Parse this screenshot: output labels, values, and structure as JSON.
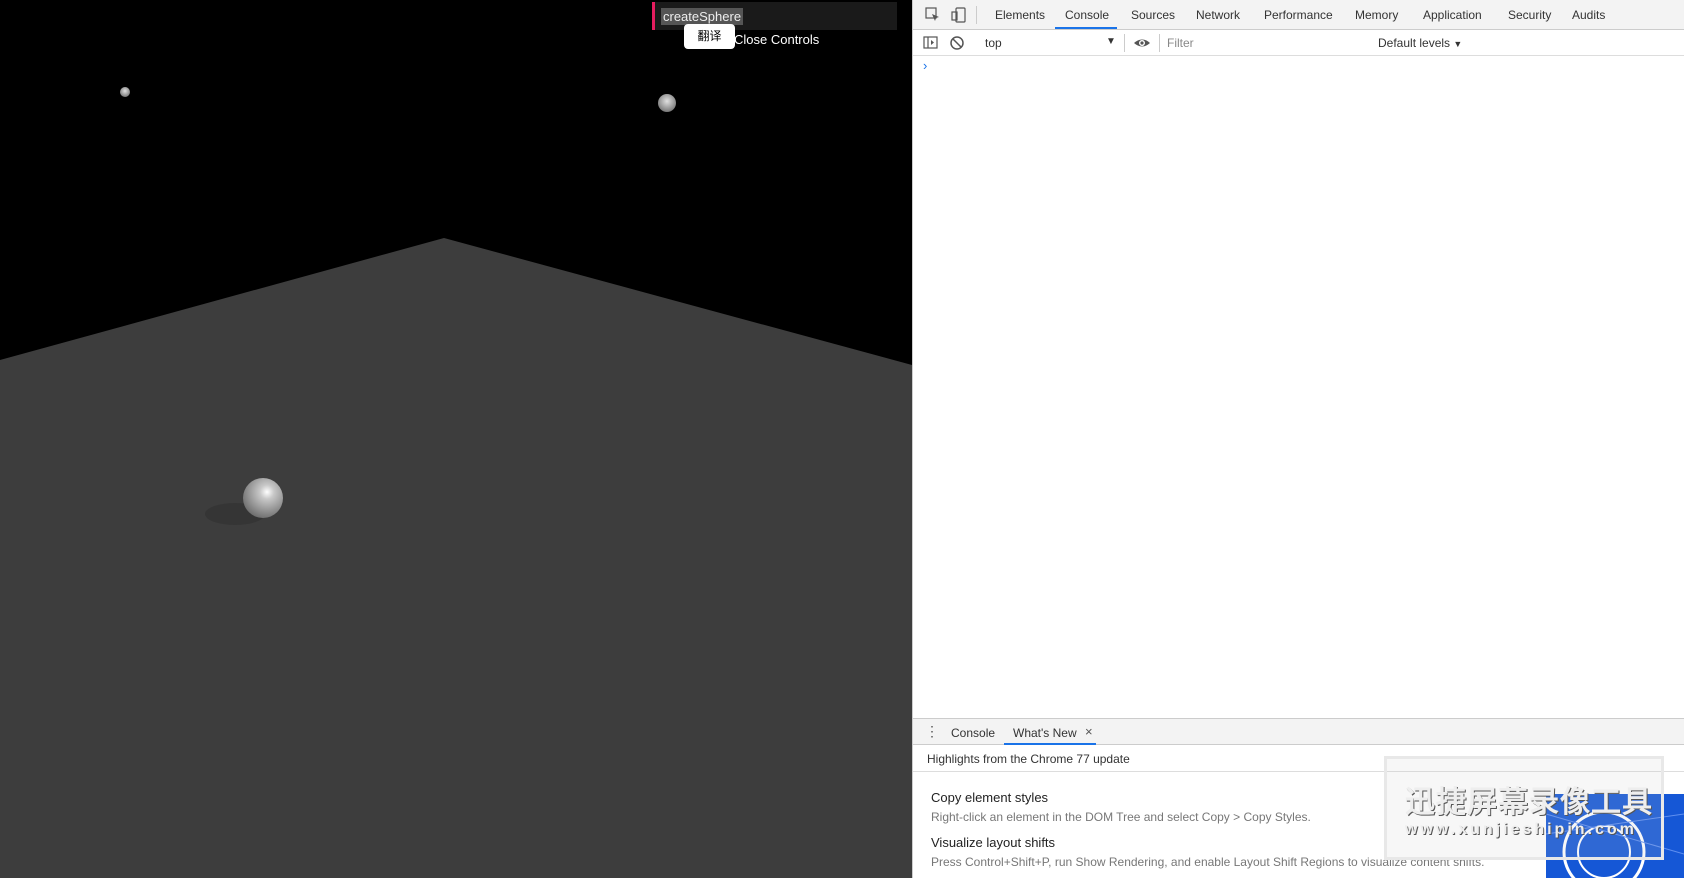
{
  "scene": {
    "gui_controller_name": "createSphere",
    "close_controls_label": "Close Controls",
    "translate_popup_label": "翻译"
  },
  "devtools": {
    "tabs": [
      "Elements",
      "Console",
      "Sources",
      "Network",
      "Performance",
      "Memory",
      "Application",
      "Security",
      "Audits"
    ],
    "active_tab": "Console",
    "console_toolbar": {
      "context": "top",
      "filter_placeholder": "Filter",
      "levels": "Default levels"
    },
    "drawer": {
      "tabs": [
        "Console",
        "What's New"
      ],
      "active_tab": "What's New",
      "header": "Highlights from the Chrome 77 update",
      "items": [
        {
          "title": "Copy element styles",
          "description": "Right-click an element in the DOM Tree and select Copy > Copy Styles."
        },
        {
          "title": "Visualize layout shifts",
          "description": "Press Control+Shift+P, run Show Rendering, and enable Layout Shift Regions to visualize content shifts."
        }
      ]
    },
    "accent_color": "#1a73e8"
  },
  "watermark": {
    "title": "迅捷屏幕录像工具",
    "url": "www.xunjieshipin.com"
  }
}
